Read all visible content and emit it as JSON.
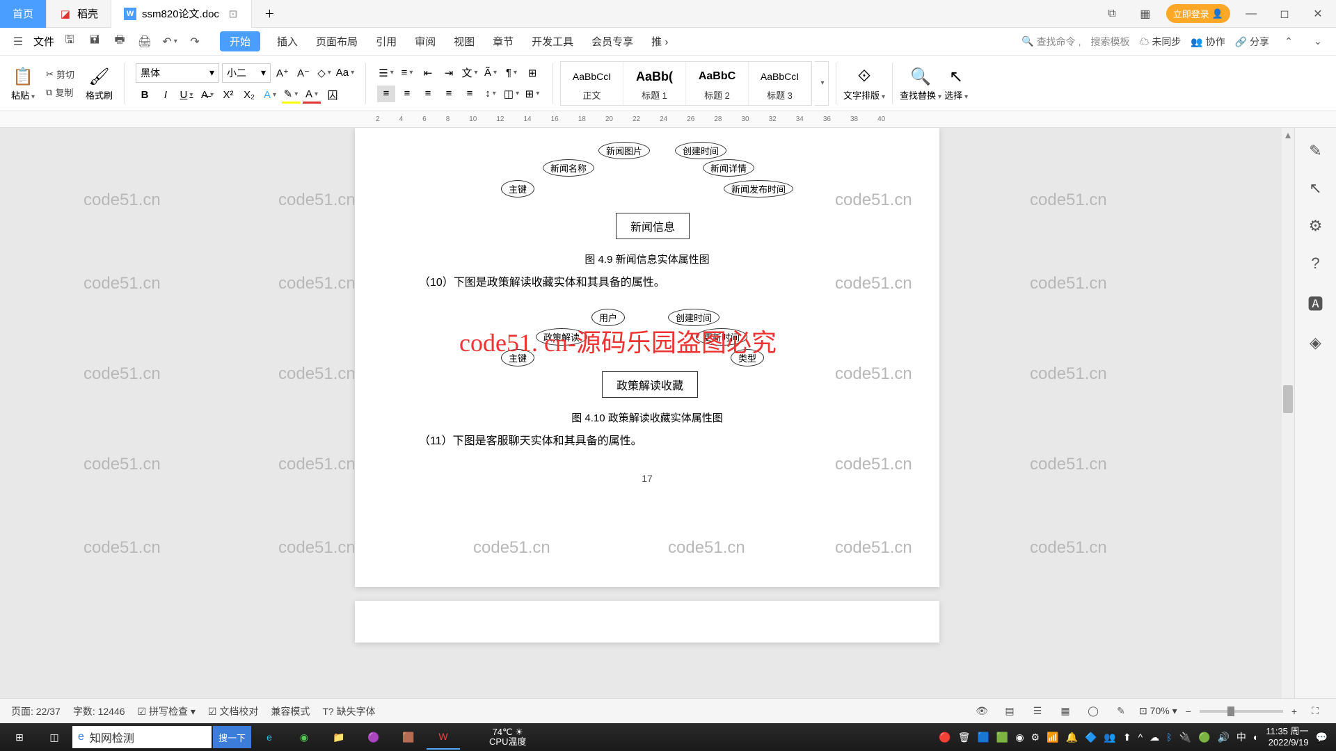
{
  "tabs": {
    "home": "首页",
    "docke": "稻壳",
    "doc": "ssm820论文.doc",
    "add": "＋"
  },
  "titlebar": {
    "login": "立即登录"
  },
  "toolbar1": {
    "file": "文件"
  },
  "menu": {
    "start": "开始",
    "insert": "插入",
    "layout": "页面布局",
    "ref": "引用",
    "review": "审阅",
    "view": "视图",
    "chapter": "章节",
    "devtools": "开发工具",
    "member": "会员专享",
    "more": "推"
  },
  "toolbar_right": {
    "search_cmd": "查找命令",
    "search_tpl": "搜索模板",
    "unsync": "未同步",
    "collab": "协作",
    "share": "分享"
  },
  "ribbon": {
    "paste": "粘贴",
    "cut": "剪切",
    "copy": "复制",
    "brush": "格式刷",
    "font_name": "黑体",
    "font_size": "小二",
    "styles": [
      {
        "preview": "AaBbCcI",
        "name": "正文"
      },
      {
        "preview": "AaBb(",
        "name": "标题 1"
      },
      {
        "preview": "AaBbC",
        "name": "标题 2"
      },
      {
        "preview": "AaBbCcI",
        "name": "标题 3"
      }
    ],
    "text_layout": "文字排版",
    "find_replace": "查找替换",
    "select": "选择"
  },
  "doc": {
    "er1": {
      "entity": "新闻信息",
      "attrs": [
        "主键",
        "新闻名称",
        "新闻图片",
        "创建时间",
        "新闻详情",
        "新闻发布时间"
      ]
    },
    "caption1": "图 4.9  新闻信息实体属性图",
    "p10": "（10）下图是政策解读收藏实体和其具备的属性。",
    "er2": {
      "entity": "政策解读收藏",
      "attrs": [
        "主键",
        "政策解读",
        "用户",
        "创建时间",
        "更新时间",
        "类型"
      ]
    },
    "caption2": "图 4.10  政策解读收藏实体属性图",
    "p11": "（11）下图是客服聊天实体和其具备的属性。",
    "pagenum": "17",
    "wm_red": "code51. cn-源码乐园盗图必究",
    "wm_grey": "code51.cn"
  },
  "status": {
    "page": "页面: 22/37",
    "words": "字数: 12446",
    "spell": "拼写检查",
    "proof": "文档校对",
    "compat": "兼容模式",
    "missing_font": "缺失字体",
    "zoom": "70%"
  },
  "taskbar": {
    "search_text": "知网检测",
    "search_btn": "搜一下",
    "temp": "74℃",
    "temp_label": "CPU温度",
    "time": "11:35",
    "day": "周一",
    "date": "2022/9/19",
    "ime": "中"
  }
}
